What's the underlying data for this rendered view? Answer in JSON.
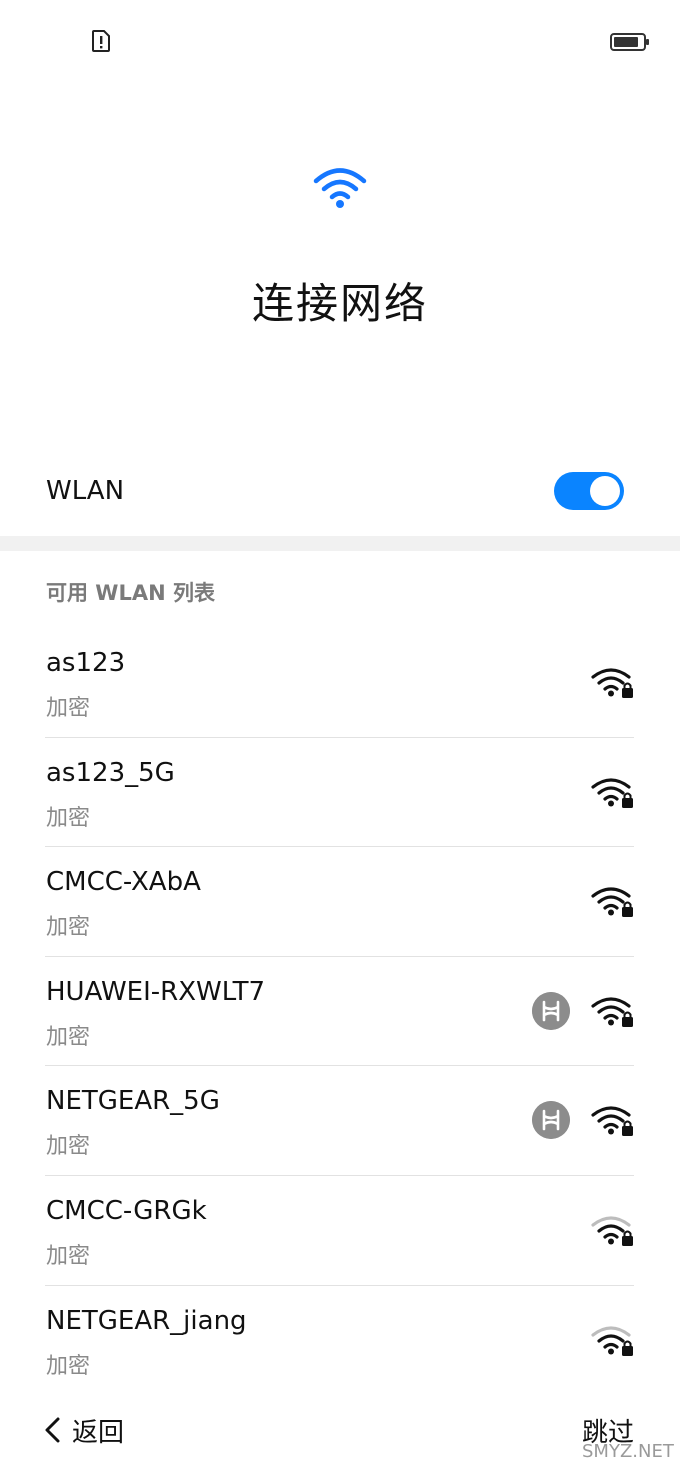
{
  "status_bar": {
    "sim_icon": "sim-alert-icon",
    "battery_icon": "battery-icon"
  },
  "hero": {
    "icon": "wifi-icon",
    "title": "连接网络",
    "accent_color": "#1677ff"
  },
  "wlan": {
    "label": "WLAN",
    "toggle_on": true,
    "toggle_color": "#0a84ff"
  },
  "available": {
    "header": "可用 WLAN 列表"
  },
  "networks": [
    {
      "ssid": "as123",
      "security": "加密",
      "hilink": false,
      "strength": "full"
    },
    {
      "ssid": "as123_5G",
      "security": "加密",
      "hilink": false,
      "strength": "full"
    },
    {
      "ssid": "CMCC-XAbA",
      "security": "加密",
      "hilink": false,
      "strength": "full"
    },
    {
      "ssid": "HUAWEI-RXWLT7",
      "security": "加密",
      "hilink": true,
      "strength": "full"
    },
    {
      "ssid": "NETGEAR_5G",
      "security": "加密",
      "hilink": true,
      "strength": "full"
    },
    {
      "ssid": "CMCC-GRGk",
      "security": "加密",
      "hilink": false,
      "strength": "medium"
    },
    {
      "ssid": "NETGEAR_jiang",
      "security": "加密",
      "hilink": false,
      "strength": "medium"
    }
  ],
  "footer": {
    "back_label": "返回",
    "skip_label": "跳过"
  },
  "watermark": "SMYZ.NET"
}
